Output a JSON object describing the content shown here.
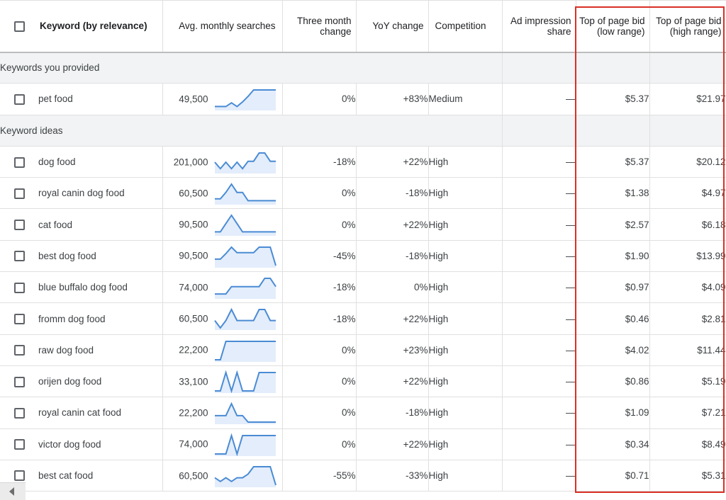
{
  "header": {
    "keyword": "Keyword (by relevance)",
    "avg_searches": "Avg. monthly searches",
    "three_month": "Three month change",
    "yoy": "YoY change",
    "competition": "Competition",
    "ad_share": "Ad impression share",
    "bid_low": "Top of page bid (low range)",
    "bid_high": "Top of page bid (high range)"
  },
  "groups": {
    "provided": "Keywords you provided",
    "ideas": "Keyword ideas"
  },
  "colors": {
    "trend_line": "#4a8bd4",
    "trend_fill": "#e3edfb",
    "highlight": "#d93025"
  },
  "provided_rows": [
    {
      "keyword": "pet food",
      "volume": "49,500",
      "three_month": "0%",
      "yoy": "+83%",
      "competition": "Medium",
      "ad_share": "—",
      "bid_low": "$5.37",
      "bid_high": "$21.97",
      "trend": [
        0.1,
        0.1,
        0.1,
        0.3,
        0.1,
        0.35,
        0.65,
        1,
        1,
        1,
        1,
        1
      ]
    }
  ],
  "idea_rows": [
    {
      "keyword": "dog food",
      "volume": "201,000",
      "three_month": "-18%",
      "yoy": "+22%",
      "competition": "High",
      "ad_share": "—",
      "bid_low": "$5.37",
      "bid_high": "$20.12",
      "trend": [
        0.5,
        0.15,
        0.5,
        0.15,
        0.5,
        0.15,
        0.55,
        0.55,
        1,
        1,
        0.55,
        0.55
      ]
    },
    {
      "keyword": "royal canin dog food",
      "volume": "60,500",
      "three_month": "0%",
      "yoy": "-18%",
      "competition": "High",
      "ad_share": "—",
      "bid_low": "$1.38",
      "bid_high": "$4.97",
      "trend": [
        0.2,
        0.2,
        0.55,
        1,
        0.55,
        0.55,
        0.1,
        0.1,
        0.1,
        0.1,
        0.1,
        0.1
      ]
    },
    {
      "keyword": "cat food",
      "volume": "90,500",
      "three_month": "0%",
      "yoy": "+22%",
      "competition": "High",
      "ad_share": "—",
      "bid_low": "$2.57",
      "bid_high": "$6.18",
      "trend": [
        0.1,
        0.1,
        0.55,
        1,
        0.55,
        0.1,
        0.1,
        0.1,
        0.1,
        0.1,
        0.1,
        0.1
      ]
    },
    {
      "keyword": "best dog food",
      "volume": "90,500",
      "three_month": "-45%",
      "yoy": "-18%",
      "competition": "High",
      "ad_share": "—",
      "bid_low": "$1.90",
      "bid_high": "$13.99",
      "trend": [
        0.35,
        0.35,
        0.65,
        1,
        0.7,
        0.7,
        0.7,
        0.7,
        1,
        1,
        1,
        0
      ]
    },
    {
      "keyword": "blue buffalo dog food",
      "volume": "74,000",
      "three_month": "-18%",
      "yoy": "0%",
      "competition": "High",
      "ad_share": "—",
      "bid_low": "$0.97",
      "bid_high": "$4.09",
      "trend": [
        0.15,
        0.15,
        0.15,
        0.55,
        0.55,
        0.55,
        0.55,
        0.55,
        0.55,
        1,
        1,
        0.55
      ]
    },
    {
      "keyword": "fromm dog food",
      "volume": "60,500",
      "three_month": "-18%",
      "yoy": "+22%",
      "competition": "High",
      "ad_share": "—",
      "bid_low": "$0.46",
      "bid_high": "$2.81",
      "trend": [
        0.4,
        0,
        0.4,
        1,
        0.4,
        0.4,
        0.4,
        0.4,
        1,
        1,
        0.4,
        0.4
      ]
    },
    {
      "keyword": "raw dog food",
      "volume": "22,200",
      "three_month": "0%",
      "yoy": "+23%",
      "competition": "High",
      "ad_share": "—",
      "bid_low": "$4.02",
      "bid_high": "$11.44",
      "trend": [
        0,
        0,
        1,
        1,
        1,
        1,
        1,
        1,
        1,
        1,
        1,
        1
      ]
    },
    {
      "keyword": "orijen dog food",
      "volume": "33,100",
      "three_month": "0%",
      "yoy": "+22%",
      "competition": "High",
      "ad_share": "—",
      "bid_low": "$0.86",
      "bid_high": "$5.19",
      "trend": [
        0,
        0,
        1,
        0,
        1,
        0,
        0,
        0,
        1,
        1,
        1,
        1
      ]
    },
    {
      "keyword": "royal canin cat food",
      "volume": "22,200",
      "three_month": "0%",
      "yoy": "-18%",
      "competition": "High",
      "ad_share": "—",
      "bid_low": "$1.09",
      "bid_high": "$7.21",
      "trend": [
        0.35,
        0.35,
        0.35,
        1,
        0.35,
        0.35,
        0,
        0,
        0,
        0,
        0,
        0
      ]
    },
    {
      "keyword": "victor dog food",
      "volume": "74,000",
      "three_month": "0%",
      "yoy": "+22%",
      "competition": "High",
      "ad_share": "—",
      "bid_low": "$0.34",
      "bid_high": "$8.49",
      "trend": [
        0,
        0,
        0,
        1,
        0,
        1,
        1,
        1,
        1,
        1,
        1,
        1
      ]
    },
    {
      "keyword": "best cat food",
      "volume": "60,500",
      "three_month": "-55%",
      "yoy": "-33%",
      "competition": "High",
      "ad_share": "—",
      "bid_low": "$0.71",
      "bid_high": "$5.31",
      "trend": [
        0.4,
        0.2,
        0.4,
        0.2,
        0.4,
        0.4,
        0.6,
        1,
        1,
        1,
        1,
        0
      ]
    }
  ]
}
